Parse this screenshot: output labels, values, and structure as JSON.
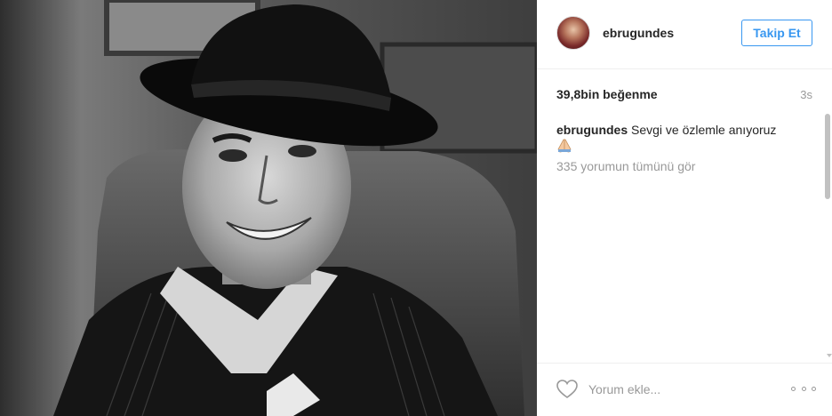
{
  "post": {
    "image_alt": "Black and white portrait photo",
    "header": {
      "username": "ebrugundes",
      "follow_label": "Takip Et"
    },
    "stats": {
      "likes": "39,8bin beğenme",
      "time": "3s"
    },
    "caption": {
      "username": "ebrugundes",
      "text": " Sevgi ve özlemle anıyoruz"
    },
    "view_comments": "335 yorumun tümünü gör",
    "footer": {
      "comment_placeholder": "Yorum ekle..."
    }
  },
  "icons": {
    "like": "heart-icon",
    "more": "more-options-icon",
    "emoji": "praying-hands-emoji"
  },
  "colors": {
    "accent": "#3897f0",
    "muted": "#999999",
    "text": "#262626"
  }
}
